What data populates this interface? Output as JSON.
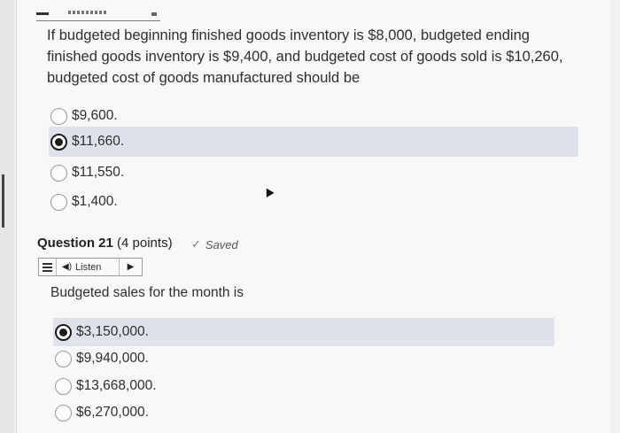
{
  "question_1": {
    "text": "If budgeted beginning finished goods inventory is $8,000, budgeted ending finished goods inventory is $9,400, and budgeted cost of goods sold is $10,260, budgeted cost of goods manufactured should be",
    "options": [
      {
        "label": "$9,600.",
        "selected": false
      },
      {
        "label": "$11,660.",
        "selected": true
      },
      {
        "label": "$11,550.",
        "selected": false
      },
      {
        "label": "$1,400.",
        "selected": false
      }
    ]
  },
  "question_21": {
    "title": "Question 21",
    "points": "(4 points)",
    "status": "Saved",
    "listen_label": "Listen",
    "text": "Budgeted sales for the month is",
    "options": [
      {
        "label": "$3,150,000.",
        "selected": true
      },
      {
        "label": "$9,940,000.",
        "selected": false
      },
      {
        "label": "$13,668,000.",
        "selected": false
      },
      {
        "label": "$6,270,000.",
        "selected": false
      }
    ]
  },
  "colors": {
    "selected_row_bg": "#dfe2ea",
    "page_bg": "#f8f8f6"
  }
}
